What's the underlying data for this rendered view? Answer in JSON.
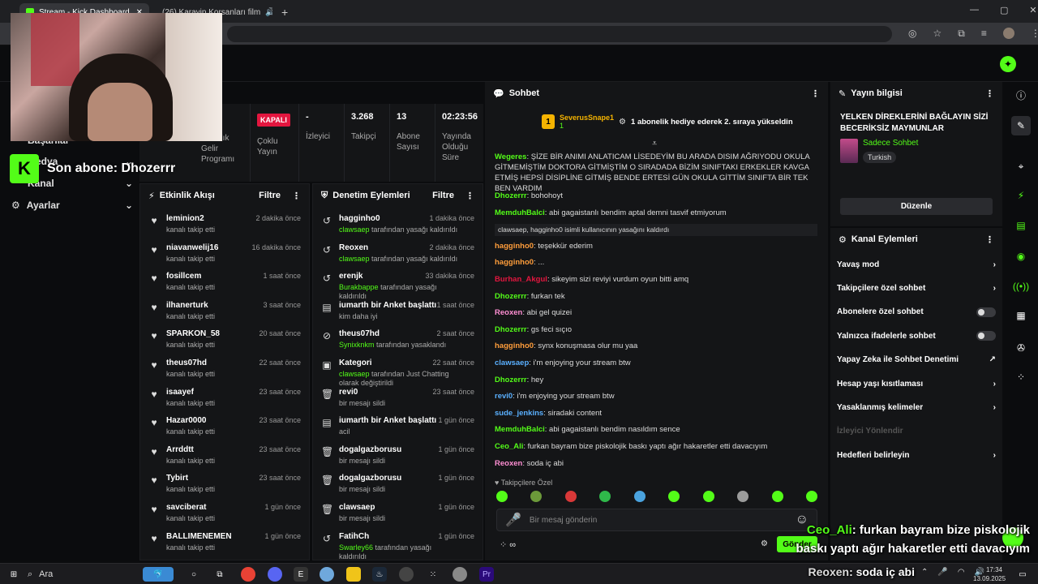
{
  "browser": {
    "tabs": [
      {
        "label": "Stream - Kick Dashboard"
      },
      {
        "label": "(26) Karayip Korsanları film"
      }
    ]
  },
  "overlay": {
    "last_sub": "Son abone: Dhozerrr"
  },
  "sidebar": {
    "items": [
      {
        "label": "Başarılar"
      },
      {
        "label": "Medya"
      },
      {
        "label": "Kanal"
      },
      {
        "label": "Ayarlar"
      }
    ]
  },
  "stats": {
    "partner": {
      "label": "Ortaklık Gelir Programı"
    },
    "multistream": {
      "badge": "KAPALI",
      "label": "Çoklu Yayın"
    },
    "viewers": {
      "value": "-",
      "label": "İzleyici"
    },
    "followers": {
      "value": "3.268",
      "label": "Takipçi"
    },
    "subs": {
      "value": "13",
      "label": "Abone Sayısı"
    },
    "uptime": {
      "value": "02:23:56",
      "label": "Yayında Olduğu Süre"
    }
  },
  "activity": {
    "title": "Etkinlik Akışı",
    "filter": "Filtre",
    "items": [
      {
        "name": "leminion2",
        "sub": "kanalı takip etti",
        "time": "2 dakika önce"
      },
      {
        "name": "niavanwelij16",
        "sub": "kanalı takip etti",
        "time": "16 dakika önce"
      },
      {
        "name": "fosillcem",
        "sub": "kanalı takip etti",
        "time": "1 saat önce"
      },
      {
        "name": "ilhanerturk",
        "sub": "kanalı takip etti",
        "time": "3 saat önce"
      },
      {
        "name": "SPARKON_58",
        "sub": "kanalı takip etti",
        "time": "20 saat önce"
      },
      {
        "name": "theus07hd",
        "sub": "kanalı takip etti",
        "time": "22 saat önce"
      },
      {
        "name": "isaayef",
        "sub": "kanalı takip etti",
        "time": "23 saat önce"
      },
      {
        "name": "Hazar0000",
        "sub": "kanalı takip etti",
        "time": "23 saat önce"
      },
      {
        "name": "Arrddtt",
        "sub": "kanalı takip etti",
        "time": "23 saat önce"
      },
      {
        "name": "Tybirt",
        "sub": "kanalı takip etti",
        "time": "23 saat önce"
      },
      {
        "name": "savciberat",
        "sub": "kanalı takip etti",
        "time": "1 gün önce"
      },
      {
        "name": "BALLIMENEMEN",
        "sub": "kanalı takip etti",
        "time": "1 gün önce"
      }
    ]
  },
  "moderation": {
    "title": "Denetim Eylemleri",
    "filter": "Filtre",
    "items": [
      {
        "name": "hagginho0",
        "actor": "clawsaep",
        "sub": "tarafından yasağı kaldırıldı",
        "time": "1 dakika önce",
        "icon": "↺"
      },
      {
        "name": "Reoxen",
        "actor": "clawsaep",
        "sub": "tarafından yasağı kaldırıldı",
        "time": "2 dakika önce",
        "icon": "↺"
      },
      {
        "name": "erenjk",
        "actor": "Burakbappe",
        "sub": "tarafından yasağı kaldırıldı",
        "time": "33 dakika önce",
        "icon": "↺"
      },
      {
        "name": "iumarth bir Anket başlattı",
        "actor": "",
        "sub": "kim daha iyi",
        "time": "1 saat önce",
        "icon": "▤"
      },
      {
        "name": "theus07hd",
        "actor": "Synixknkm",
        "sub": "tarafından yasaklandı",
        "time": "2 saat önce",
        "icon": "⊘"
      },
      {
        "name": "Kategori",
        "actor": "clawsaep",
        "sub": "tarafından Just Chatting olarak değiştirildi",
        "time": "22 saat önce",
        "icon": "▣"
      },
      {
        "name": "revi0",
        "actor": "",
        "sub": "bir mesajı sildi",
        "time": "23 saat önce",
        "icon": "🗑"
      },
      {
        "name": "iumarth bir Anket başlattı",
        "actor": "",
        "sub": "acil",
        "time": "1 gün önce",
        "icon": "▤"
      },
      {
        "name": "dogalgazborusu",
        "actor": "",
        "sub": "bir mesajı sildi",
        "time": "1 gün önce",
        "icon": "🗑"
      },
      {
        "name": "dogalgazborusu",
        "actor": "",
        "sub": "bir mesajı sildi",
        "time": "1 gün önce",
        "icon": "🗑"
      },
      {
        "name": "clawsaep",
        "actor": "",
        "sub": "bir mesajı sildi",
        "time": "1 gün önce",
        "icon": "🗑"
      },
      {
        "name": "FatihCh",
        "actor": "Swarley66",
        "sub": "tarafından yasağı kaldırıldı",
        "time": "1 gün önce",
        "icon": "↺"
      }
    ]
  },
  "chat": {
    "title": "Sohbet",
    "pinned": {
      "user": "SeverusSnape1",
      "count": "1",
      "text": "1 abonelik hediye ederek 2. sıraya yükseldin"
    },
    "messages": [
      {
        "user": "Wegeres",
        "color": "#53fc18",
        "text": "ŞİZE BİR ANIMI ANLATICAM LİSEDEYİM BU ARADA DISIM AĞRIYODU OKULA GİTMEMİŞTİM DOKTORA GİTMİŞTİM O SIRADADA BİZİM SINIFTAKI ERKEKLER KAVGA ETMİŞ HEPSİ DİSİPLİNE GİTMİŞ BENDE ERTESİ GÜN OKULA GİTTİM SINIFTA BİR TEK BEN VARDIM"
      },
      {
        "user": "Dhozerrr",
        "color": "#53fc18",
        "text": "bohohoyt"
      },
      {
        "user": "MemduhBalci",
        "color": "#53fc18",
        "text": "abi gagaistanlı bendim aptal demni tasvif etmiyorum"
      },
      {
        "user": "",
        "color": "#ddd",
        "text": "clawsaep, hagginho0 isimli kullanıcının yasağını kaldırdı"
      },
      {
        "user": "hagginho0",
        "color": "#ff9d3b",
        "text": "teşekkür ederim"
      },
      {
        "user": "hagginho0",
        "color": "#ff9d3b",
        "text": "..."
      },
      {
        "user": "Burhan_Akgul",
        "color": "#e3163f",
        "text": "sikeyim sizi reviyi vurdum oyun bitti amq"
      },
      {
        "user": "Dhozerrr",
        "color": "#53fc18",
        "text": "furkan tek"
      },
      {
        "user": "Reoxen",
        "color": "#ff8fd3",
        "text": "abi gel quizei"
      },
      {
        "user": "Dhozerrr",
        "color": "#53fc18",
        "text": "gs feci sıçıo"
      },
      {
        "user": "hagginho0",
        "color": "#ff9d3b",
        "text": "synx konuşmasa olur mu yaa"
      },
      {
        "user": "clawsaep",
        "color": "#5ab0ff",
        "text": "i'm enjoying your stream btw"
      },
      {
        "user": "Dhozerrr",
        "color": "#53fc18",
        "text": "hey"
      },
      {
        "user": "revi0",
        "color": "#5ab0ff",
        "text": "i'm enjoying your stream btw"
      },
      {
        "user": "sude_jenkins",
        "color": "#5ab0ff",
        "text": "siradaki content"
      },
      {
        "user": "MemduhBalci",
        "color": "#53fc18",
        "text": "abi gagaistanlı bendim nasıldım sence"
      },
      {
        "user": "Ceo_Ali",
        "color": "#53fc18",
        "text": "furkan bayram bize piskolojik baskı yaptı ağır hakaretler etti davacıyım"
      },
      {
        "user": "Reoxen",
        "color": "#ff8fd3",
        "text": "soda iç abi"
      }
    ],
    "followers_only": "Takipçilere Özel",
    "input_placeholder": "Bir mesaj gönderin",
    "send": "Gönder"
  },
  "stream_info": {
    "title_label": "Yayın bilgisi",
    "title": "YELKEN DİREKLERİNİ BAĞLAYIN SİZİ BECERİKSİZ MAYMUNLAR",
    "mode": "Sadece Sohbet",
    "language": "Turkish",
    "edit": "Düzenle"
  },
  "channel_actions": {
    "title": "Kanal Eylemleri",
    "items": [
      {
        "label": "Yavaş mod",
        "kind": "chevron"
      },
      {
        "label": "Takipçilere özel sohbet",
        "kind": "chevron"
      },
      {
        "label": "Abonelere özel sohbet",
        "kind": "toggle"
      },
      {
        "label": "Yalnızca ifadelerle sohbet",
        "kind": "toggle"
      },
      {
        "label": "Yapay Zeka ile Sohbet Denetimi",
        "kind": "external"
      },
      {
        "label": "Hesap yaşı kısıtlaması",
        "kind": "chevron"
      },
      {
        "label": "Yasaklanmış kelimeler",
        "kind": "chevron"
      },
      {
        "label": "İzleyici Yönlendir",
        "kind": "disabled"
      },
      {
        "label": "Hedefleri belirleyin",
        "kind": "chevron"
      }
    ]
  },
  "stream_overlay_chat": [
    {
      "user": "Ceo_Ali",
      "text": ": furkan bayram bize piskolojik"
    },
    {
      "user": "",
      "text": "baskı yaptı ağır hakaretler etti davacıyım"
    },
    {
      "user": "Reoxen",
      "text": ": soda iç abi"
    }
  ],
  "taskbar": {
    "search": "Ara",
    "time": "17:34",
    "date": "13.09.2025"
  },
  "colors": {
    "accent": "#53fc18",
    "bg": "#0b0c0e",
    "panel": "#141517",
    "danger": "#e3163f"
  }
}
